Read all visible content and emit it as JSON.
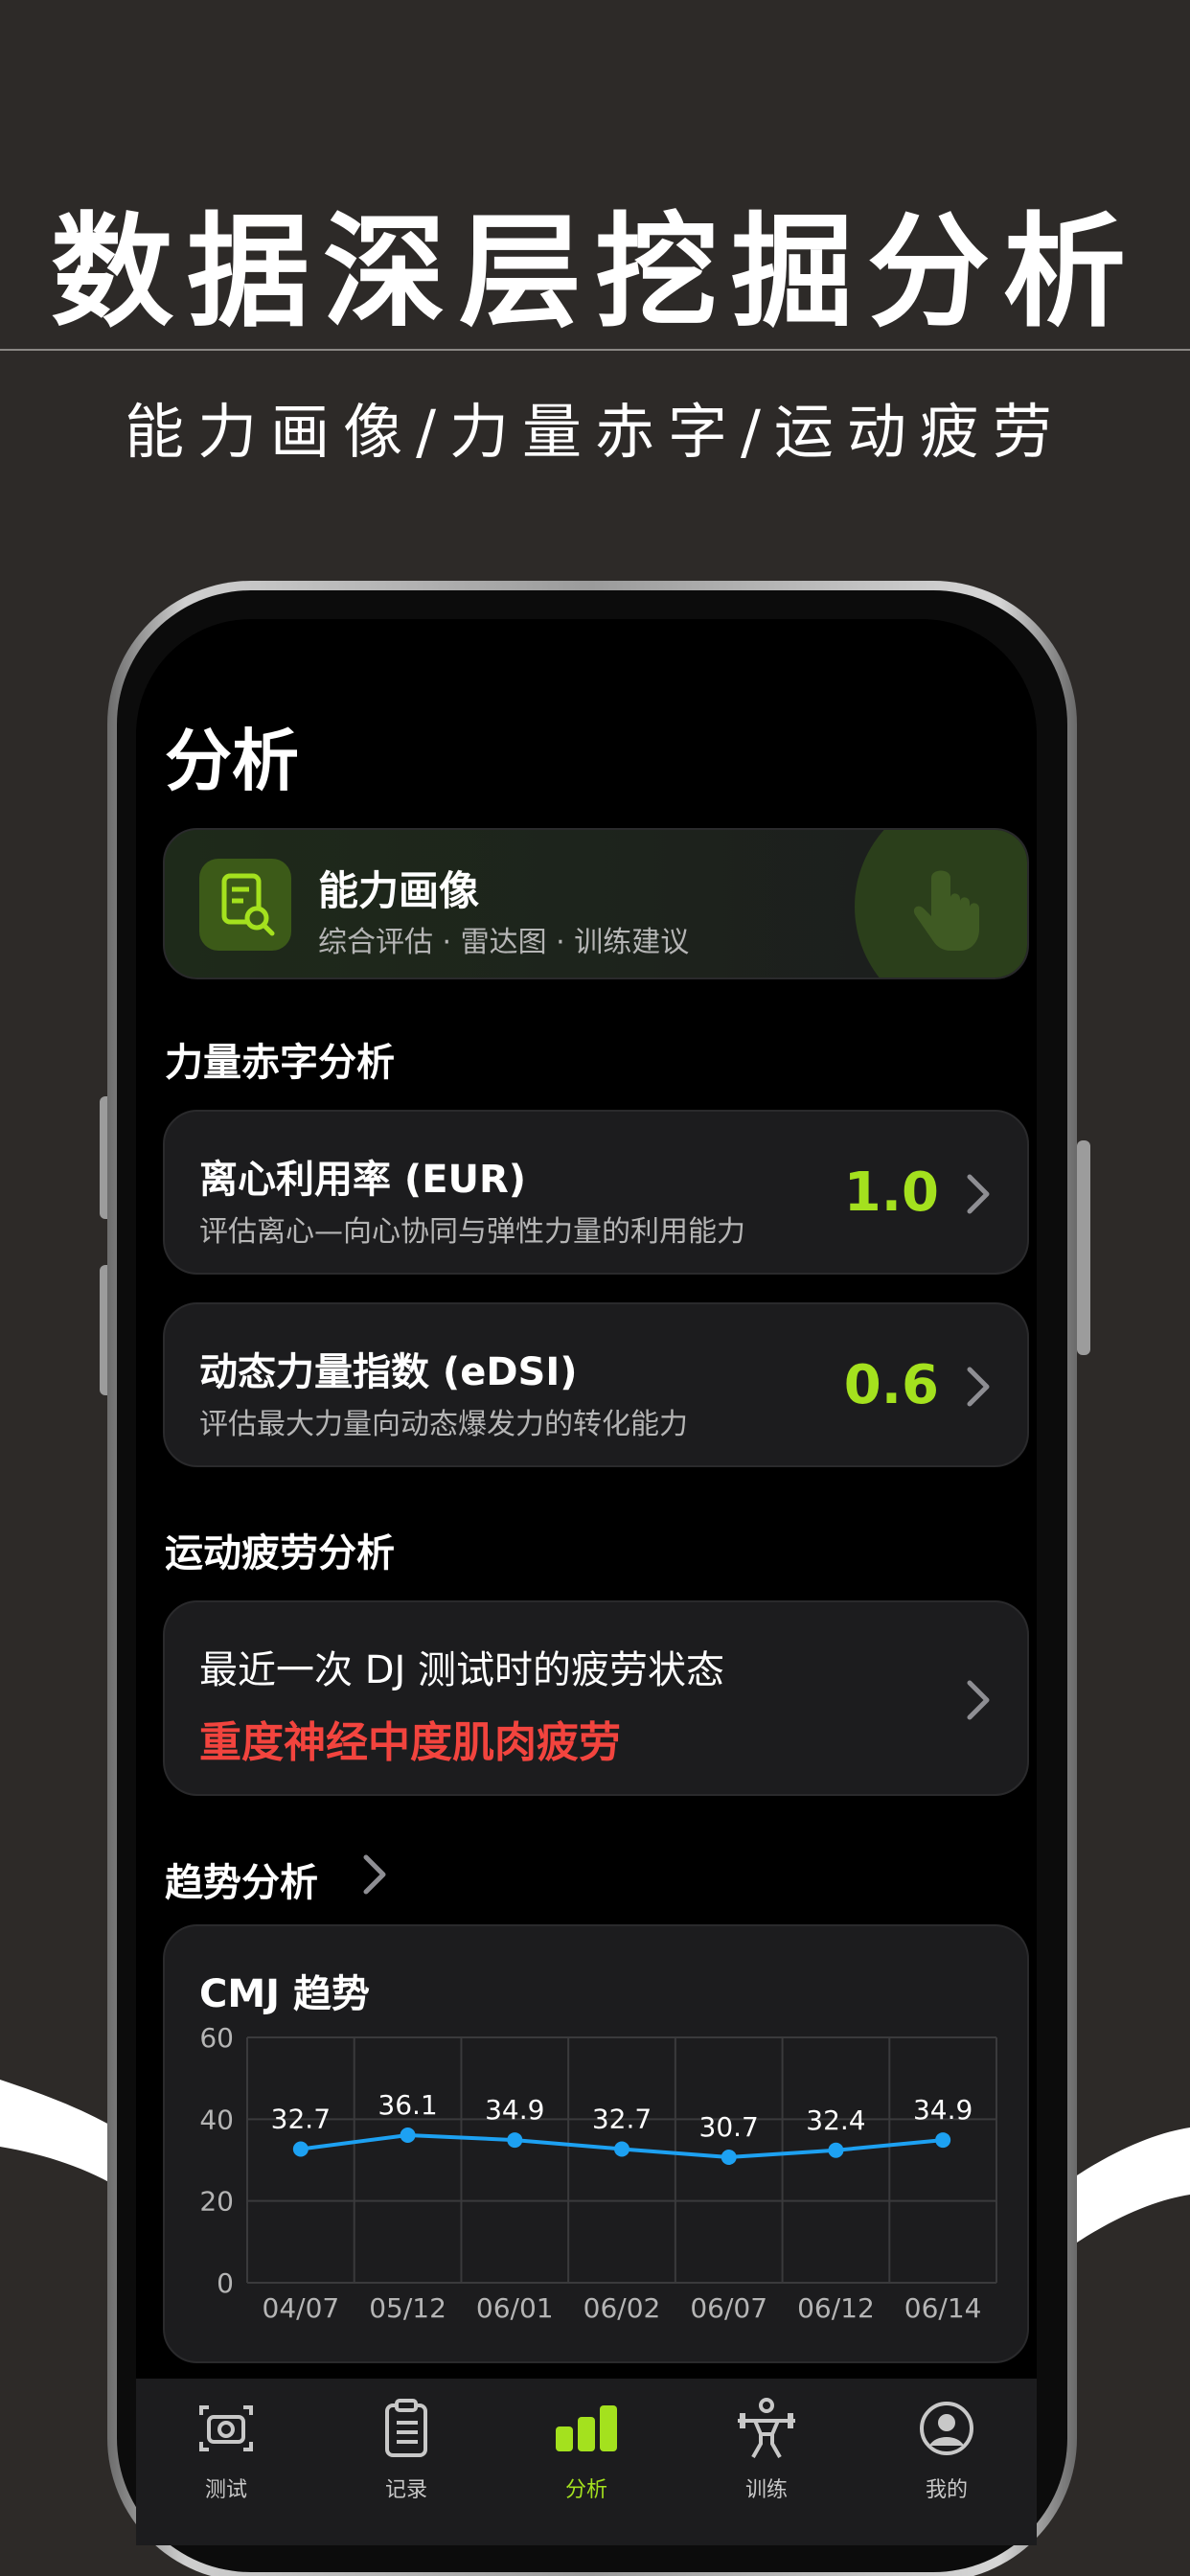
{
  "promo": {
    "headline": "数据深层挖掘分析",
    "subline": "能力画像/力量赤字/运动疲劳"
  },
  "screen": {
    "title": "分析",
    "profile_card": {
      "title": "能力画像",
      "subtitle": "综合评估 · 雷达图 · 训练建议"
    },
    "strength_section": {
      "label": "力量赤字分析",
      "items": [
        {
          "title": "离心利用率 (EUR)",
          "desc": "评估离心—向心协同与弹性力量的利用能力",
          "value": "1.0"
        },
        {
          "title": "动态力量指数 (eDSI)",
          "desc": "评估最大力量向动态爆发力的转化能力",
          "value": "0.6"
        }
      ]
    },
    "fatigue_section": {
      "label": "运动疲劳分析",
      "title": "最近一次 DJ 测试时的疲劳状态",
      "status": "重度神经中度肌肉疲劳"
    },
    "trend_section": {
      "label": "趋势分析"
    },
    "tabbar": [
      {
        "label": "测试",
        "icon": "camera-icon"
      },
      {
        "label": "记录",
        "icon": "clipboard-icon"
      },
      {
        "label": "分析",
        "icon": "bar-chart-icon",
        "active": true
      },
      {
        "label": "训练",
        "icon": "weightlifter-icon"
      },
      {
        "label": "我的",
        "icon": "user-icon"
      }
    ]
  },
  "colors": {
    "accent": "#a4e11e",
    "danger": "#f2443e",
    "line": "#1da1f2",
    "background": "#2d2a28",
    "card": "#1c1c1e"
  },
  "chart_data": {
    "type": "line",
    "title": "CMJ 趋势",
    "categories": [
      "04/07",
      "05/12",
      "06/01",
      "06/02",
      "06/07",
      "06/12",
      "06/14"
    ],
    "series": [
      {
        "values": [
          32.7,
          36.1,
          34.9,
          32.7,
          30.7,
          32.4,
          34.9
        ]
      }
    ],
    "data_labels": [
      "32.7",
      "36.1",
      "34.9",
      "32.7",
      "30.7",
      "32.4",
      "34.9"
    ],
    "y_ticks": [
      "0",
      "20",
      "40",
      "60"
    ],
    "ylim": [
      0,
      60
    ],
    "grid": true
  }
}
